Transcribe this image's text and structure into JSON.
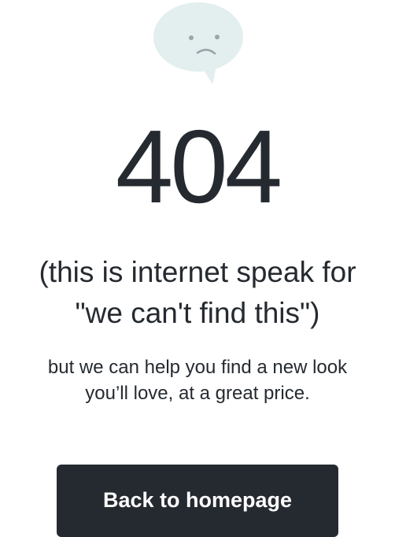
{
  "icon": {
    "name": "sad-speech-bubble-icon",
    "fill": "#e3eeee",
    "face": "#9aa6ab"
  },
  "error": {
    "code": "404",
    "explain_line1": "(this is internet speak for",
    "explain_line2": "\"we can't find this\")",
    "sub_line1": "but we can help you find a new look",
    "sub_line2": "you’ll love, at a great price."
  },
  "actions": {
    "back_label": "Back to homepage"
  },
  "colors": {
    "text": "#252a30",
    "button_bg": "#252a30",
    "button_text": "#ffffff"
  }
}
